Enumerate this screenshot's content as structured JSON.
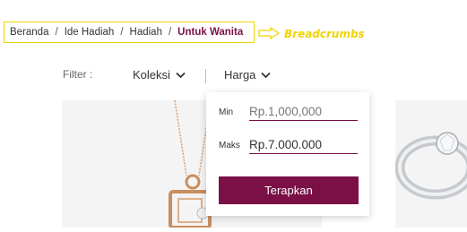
{
  "breadcrumb": {
    "items": [
      "Beranda",
      "Ide Hadiah",
      "Hadiah"
    ],
    "separator": "/",
    "current": "Untuk Wanita",
    "annotation": "Breadcrumbs"
  },
  "filter_bar": {
    "label": "Filter :",
    "collection_label": "Koleksi",
    "price_label": "Harga"
  },
  "price_panel": {
    "min_label": "Min",
    "min_placeholder": "Rp.1,000,000",
    "max_label": "Maks",
    "max_value": "Rp.7.000.000",
    "apply_label": "Terapkan"
  },
  "colors": {
    "accent": "#7a1046",
    "annotation": "#f0d400"
  },
  "icons": [
    "chevron-down-icon",
    "arrow-right-icon"
  ]
}
